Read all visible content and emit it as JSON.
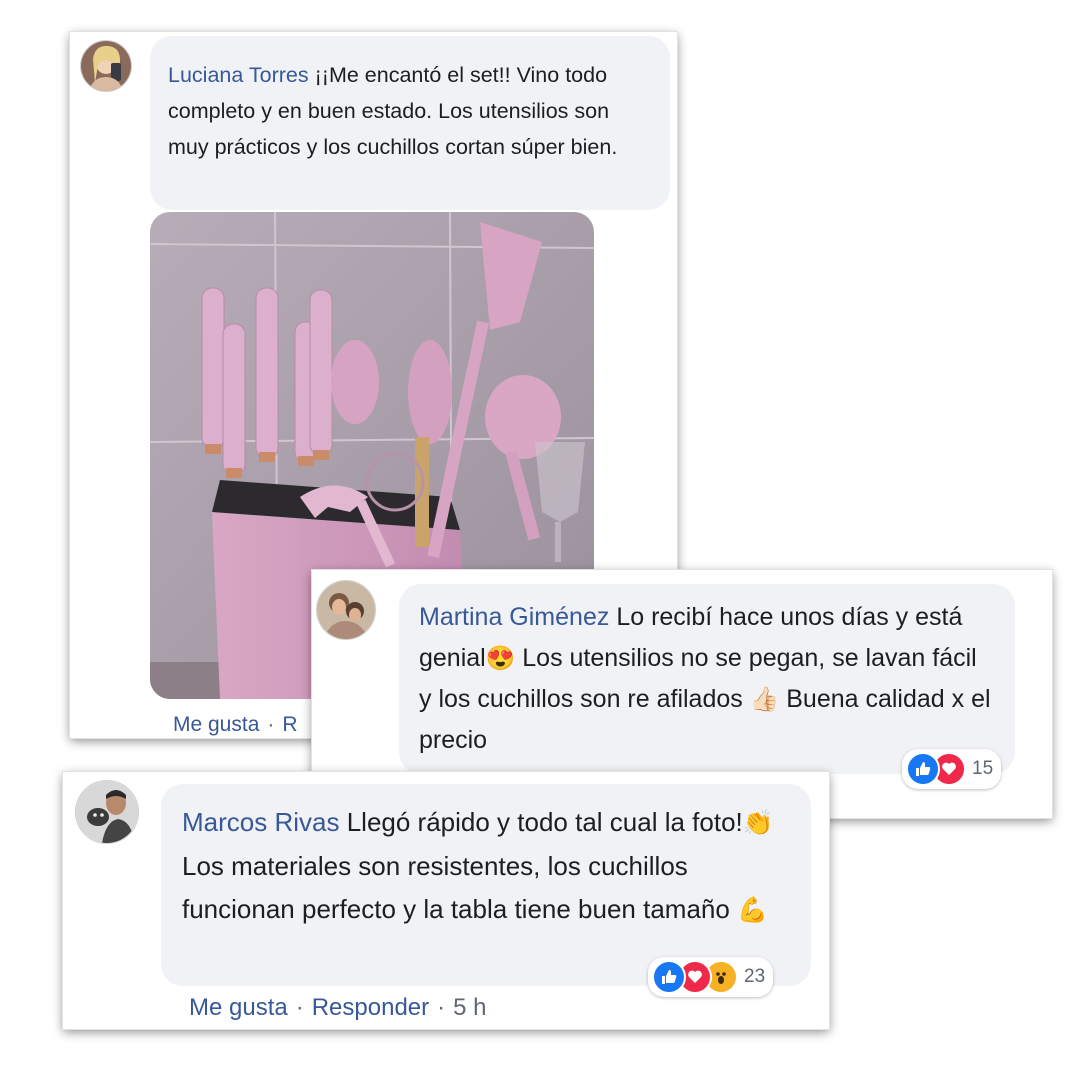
{
  "comments": [
    {
      "author": "Luciana Torres",
      "text": "¡¡Me encantó el set!! Vino todo completo y en buen estado. Los utensilios son muy prácticos y los cuchillos cortan súper bien.",
      "actions": {
        "like": "Me gusta",
        "reply_partial": "R"
      },
      "photo_subject": "pink kitchen knife and utensil set"
    },
    {
      "author": "Martina Giménez",
      "text_a": "Lo recibí hace unos días y está genial",
      "emoji_a": "😍",
      "text_b": " Los utensilios no se pegan, se lavan fácil y los cuchillos son re afilados ",
      "emoji_b": "👍🏻",
      "text_c": " Buena calidad x el precio",
      "reactions": {
        "icons": [
          "like-icon",
          "love-icon"
        ],
        "count": "15"
      }
    },
    {
      "author": "Marcos Rivas",
      "text_a": "Llegó rápido y todo tal cual la foto!",
      "emoji_a": "👏",
      "text_b": " Los materiales son resistentes, los cuchillos funcionan perfecto y la tabla tiene buen tamaño ",
      "emoji_b": "💪",
      "reactions": {
        "icons": [
          "like-icon",
          "love-icon",
          "wow-icon"
        ],
        "count": "23"
      },
      "actions": {
        "like": "Me gusta",
        "reply": "Responder",
        "time": "5 h"
      }
    }
  ],
  "colors": {
    "name": "#385898",
    "bubble": "#f0f2f5",
    "like": "#1877f2",
    "love": "#f02849",
    "wow": "#f7b125"
  }
}
